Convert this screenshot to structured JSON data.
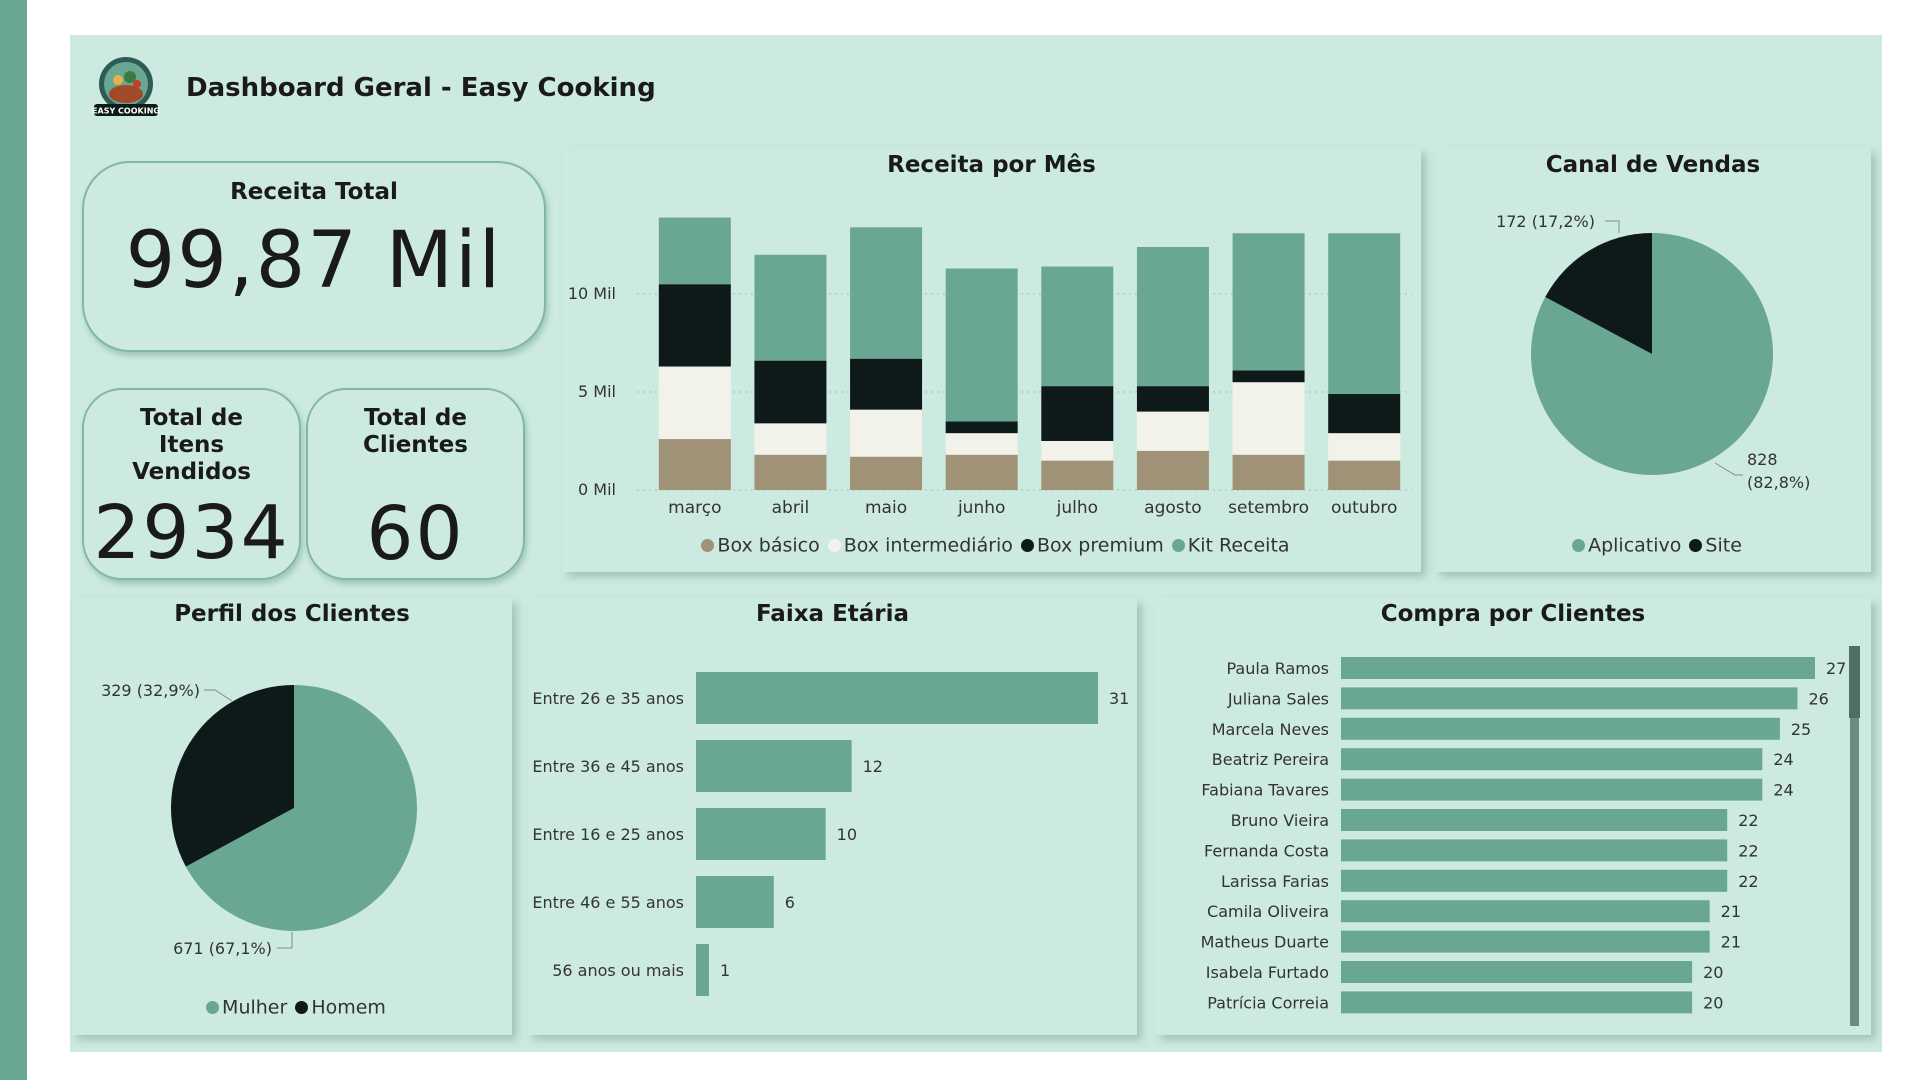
{
  "header": {
    "title": "Dashboard Geral - Easy Cooking",
    "logo_text": "EASY COOKING"
  },
  "kpis": {
    "receita_title": "Receita Total",
    "receita_value": "99,87 Mil",
    "itens_title": "Total de Itens Vendidos",
    "itens_value": "2934",
    "clientes_title": "Total de Clientes",
    "clientes_value": "60"
  },
  "colors": {
    "basico": "#a09277",
    "intermediario": "#f2f1ea",
    "premium": "#0e1a19",
    "kit": "#6aa793",
    "bar": "#6aa793"
  },
  "receita_mes": {
    "title": "Receita por Mês",
    "chart_data": {
      "type": "bar",
      "stacked": true,
      "categories": [
        "março",
        "abril",
        "maio",
        "junho",
        "julho",
        "agosto",
        "setembro",
        "outubro"
      ],
      "series": [
        {
          "name": "Box básico",
          "values": [
            2.6,
            1.8,
            1.7,
            1.8,
            1.5,
            2.0,
            1.8,
            1.5
          ]
        },
        {
          "name": "Box intermediário",
          "values": [
            3.7,
            1.6,
            2.4,
            1.1,
            1.0,
            2.0,
            3.7,
            1.4
          ]
        },
        {
          "name": "Box premium",
          "values": [
            4.2,
            3.2,
            2.6,
            0.6,
            2.8,
            1.3,
            0.6,
            2.0
          ]
        },
        {
          "name": "Kit Receita",
          "values": [
            3.4,
            5.4,
            6.7,
            7.8,
            6.1,
            7.1,
            7.0,
            8.2
          ]
        }
      ],
      "yticks": [
        "0 Mil",
        "5 Mil",
        "10 Mil"
      ],
      "ylim": [
        0,
        15
      ],
      "grid": true,
      "legend": "bottom"
    }
  },
  "canal": {
    "title": "Canal de Vendas",
    "chart_data": {
      "type": "pie",
      "labels": [
        "Aplicativo",
        "Site"
      ],
      "values": [
        828,
        172
      ],
      "data_labels": [
        "828",
        "(82,8%)",
        "172 (17,2%)"
      ],
      "legend": "bottom"
    }
  },
  "perfil": {
    "title": "Perfil dos Clientes",
    "chart_data": {
      "type": "pie",
      "labels": [
        "Mulher",
        "Homem"
      ],
      "values": [
        671,
        329
      ],
      "data_labels": [
        "671 (67,1%)",
        "329 (32,9%)"
      ],
      "legend": "bottom"
    }
  },
  "faixa": {
    "title": "Faixa Etária",
    "chart_data": {
      "type": "bar",
      "orientation": "horizontal",
      "categories": [
        "Entre 26 e 35 anos",
        "Entre 36 e 45 anos",
        "Entre 16 e 25 anos",
        "Entre 46 e 55 anos",
        "56 anos ou mais"
      ],
      "values": [
        31,
        12,
        10,
        6,
        1
      ]
    }
  },
  "compra": {
    "title": "Compra por Clientes",
    "chart_data": {
      "type": "bar",
      "orientation": "horizontal",
      "categories": [
        "Paula Ramos",
        "Juliana Sales",
        "Marcela Neves",
        "Beatriz Pereira",
        "Fabiana Tavares",
        "Bruno Vieira",
        "Fernanda Costa",
        "Larissa Farias",
        "Camila Oliveira",
        "Matheus Duarte",
        "Isabela Furtado",
        "Patrícia Correia"
      ],
      "values": [
        27,
        26,
        25,
        24,
        24,
        22,
        22,
        22,
        21,
        21,
        20,
        20
      ]
    }
  }
}
